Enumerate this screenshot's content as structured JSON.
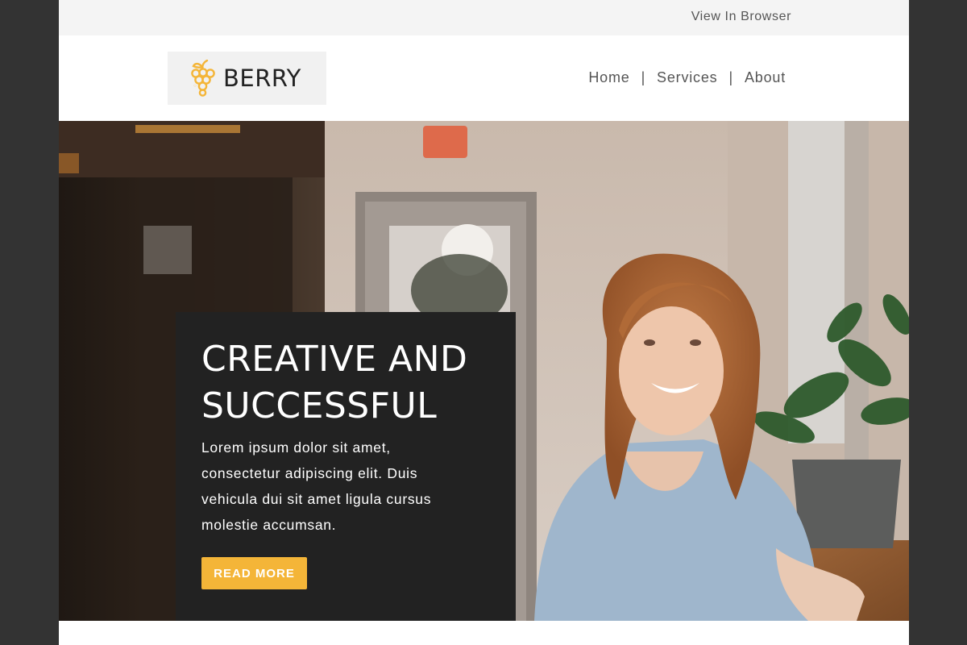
{
  "preheader": {
    "view_in_browser": "View In Browser"
  },
  "header": {
    "logo_text": "BERRY",
    "logo_icon": "grapes-icon",
    "nav": {
      "home": "Home",
      "services": "Services",
      "about": "About",
      "separator": "|"
    }
  },
  "hero": {
    "image": "photo-smiling-woman-in-cafe",
    "title_line1": "CREATIVE AND",
    "title_line2": "SUCCESSFUL",
    "text_line1": "Lorem ipsum dolor sit amet,",
    "text_line2": "consectetur adipiscing elit. Duis",
    "text_line3": "vehicula dui sit amet ligula cursus",
    "text_line4": "molestie accumsan.",
    "button": "READ MORE"
  },
  "colors": {
    "page_background": "#333333",
    "preheader_background": "#f4f4f4",
    "logo_box_background": "#f1f1f1",
    "accent": "#f4b538",
    "card_background": "#222222",
    "nav_text": "#555555"
  }
}
